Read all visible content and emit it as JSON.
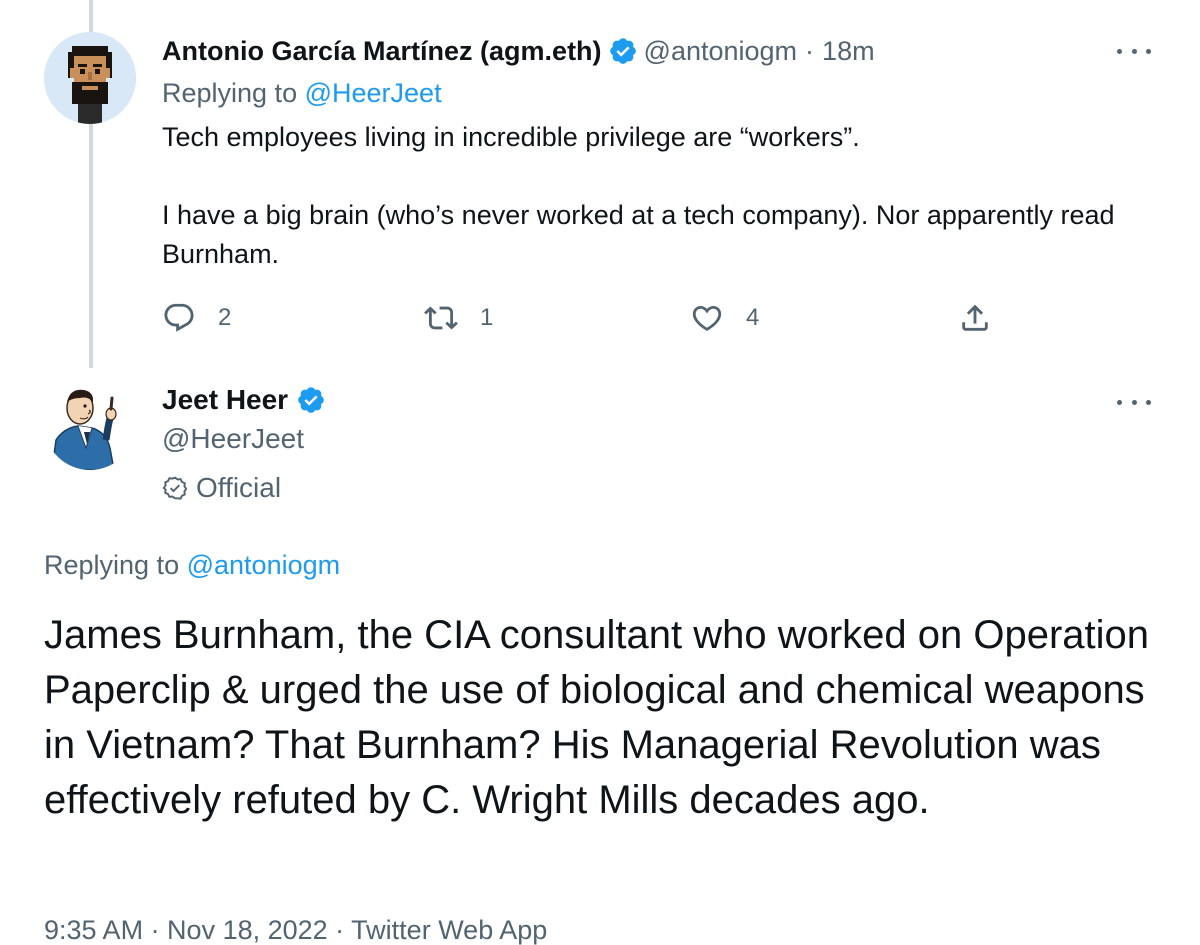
{
  "reply_tweet": {
    "author_name": "Antonio García Martínez (agm.eth)",
    "handle": "@antoniogm",
    "separator": "·",
    "time": "18m",
    "replying_prefix": "Replying to",
    "replying_to": "@HeerJeet",
    "body_paragraphs": [
      "Tech employees living in incredible privilege are “workers”.",
      "I have a big brain (who’s never worked at a tech company). Nor apparently read Burnham."
    ],
    "actions": {
      "reply_count": "2",
      "retweet_count": "1",
      "like_count": "4"
    },
    "icons": {
      "verified": "verified-badge-icon",
      "more": "more-options-icon",
      "reply": "reply-icon",
      "retweet": "retweet-icon",
      "like": "heart-icon",
      "share": "share-icon"
    }
  },
  "main_tweet": {
    "author_name": "Jeet Heer",
    "handle": "@HeerJeet",
    "official_label": "Official",
    "replying_prefix": "Replying to",
    "replying_to": "@antoniogm",
    "body": "James Burnham, the CIA consultant who worked on Operation Paperclip & urged the use of biological and chemical weapons in Vietnam? That Burnham? His Managerial Revolution was effectively refuted by C. Wright Mills decades ago.",
    "timestamp": "9:35 AM · Nov 18, 2022 · Twitter Web App"
  },
  "colors": {
    "accent": "#1d9bf0",
    "muted_text": "#536471",
    "text": "#0f1419",
    "thread_line": "#cfd9de"
  }
}
